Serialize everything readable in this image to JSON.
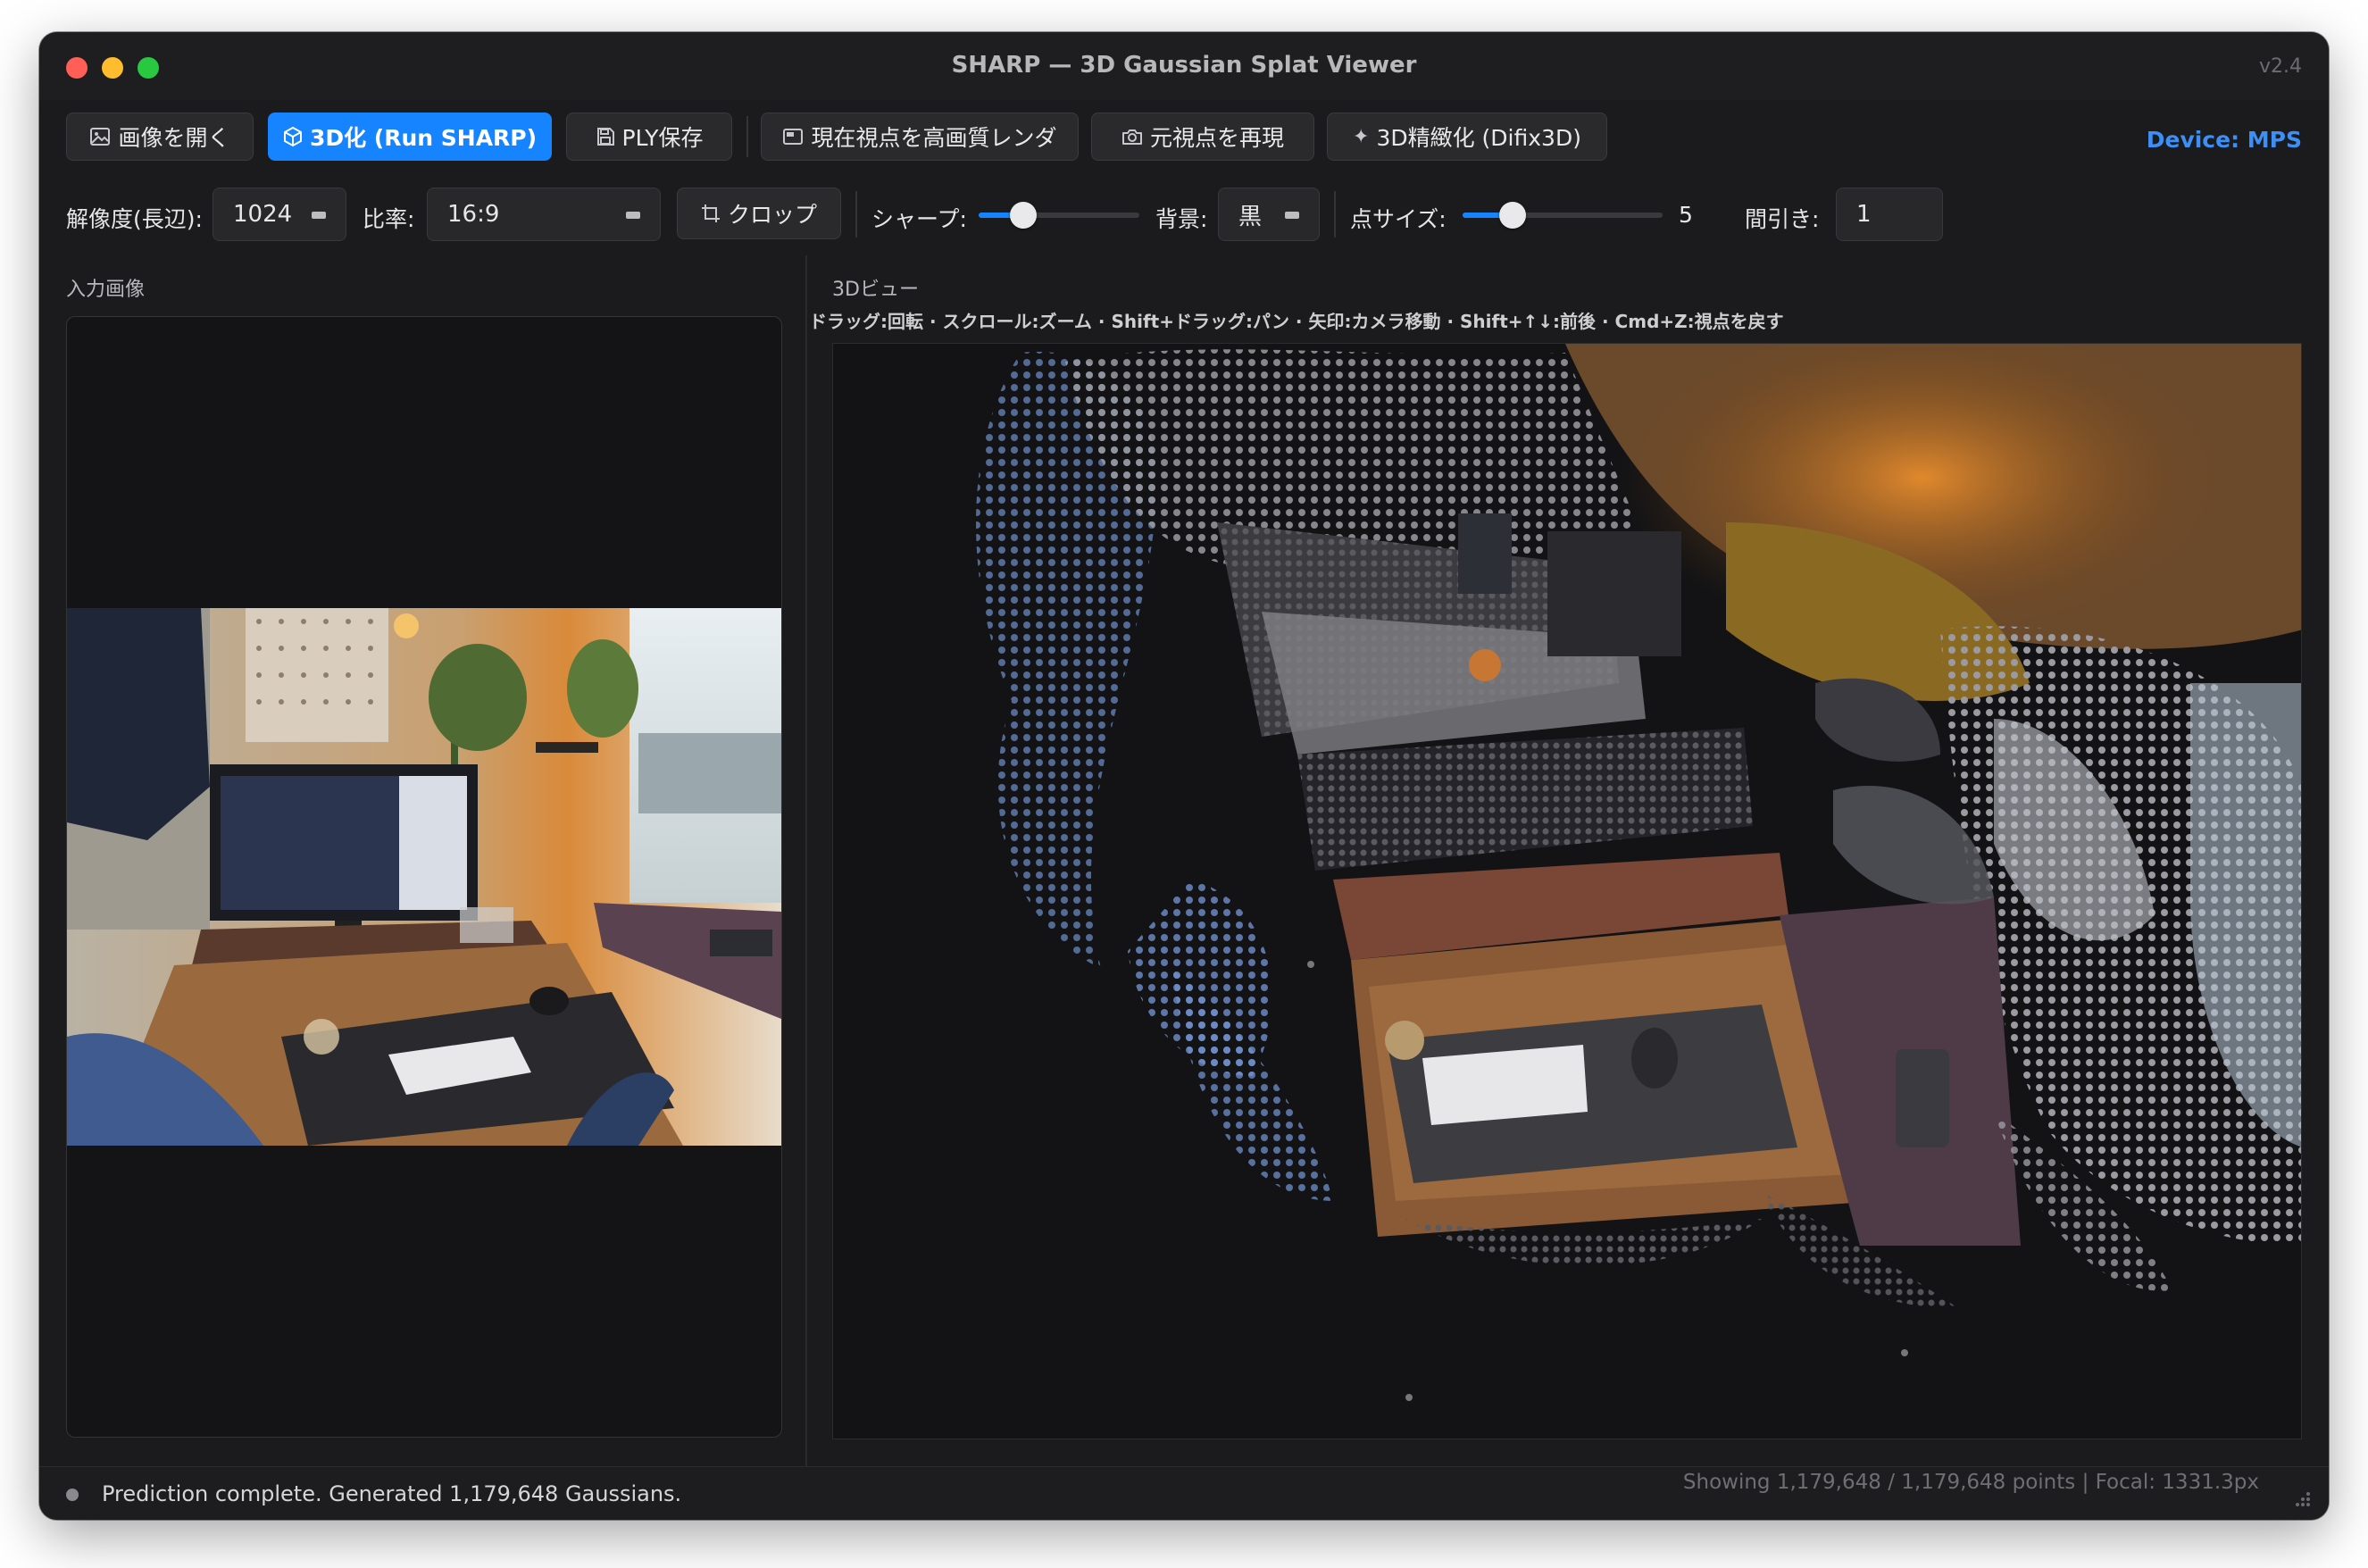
{
  "window": {
    "title": "SHARP — 3D Gaussian Splat Viewer",
    "version": "v2.4"
  },
  "toolbar": {
    "open_image": {
      "label": "画像を開く",
      "icon": "image-icon"
    },
    "run_sharp": {
      "label": "3D化 (Run SHARP)",
      "icon": "cube-icon"
    },
    "save_ply": {
      "label": "PLY保存",
      "icon": "floppy-icon"
    },
    "render_hq": {
      "label": "現在視点を高画質レンダ",
      "icon": "render-icon"
    },
    "reset_view": {
      "label": "元視点を再現",
      "icon": "camera-icon"
    },
    "refine": {
      "label": "3D精緻化 (Difix3D)",
      "icon": "sparkle-icon"
    },
    "device": "Device: MPS"
  },
  "settings": {
    "resolution_label": "解像度(長辺):",
    "resolution_value": "1024",
    "ratio_label": "比率:",
    "ratio_value": "16:9",
    "crop_label": "クロップ",
    "sharp_label": "シャープ:",
    "sharp_level": 0.28,
    "bg_label": "背景:",
    "bg_value": "黒",
    "point_size_label": "点サイズ:",
    "point_size_value": "5",
    "point_size_level": 0.25,
    "thinning_label": "間引き:",
    "thinning_value": "1"
  },
  "left_panel": {
    "title": "入力画像"
  },
  "view_panel": {
    "title": "3Dビュー",
    "hint": "ドラッグ:回転 · スクロール:ズーム · Shift+ドラッグ:パン · 矢印:カメラ移動 · Shift+↑↓:前後 · Cmd+Z:視点を戻す"
  },
  "status": {
    "message": "Prediction complete. Generated 1,179,648 Gaussians.",
    "stats": "Showing 1,179,648 / 1,179,648 points | Focal: 1331.3px"
  },
  "colors": {
    "accent": "#1684ff",
    "device": "#3d8ff5",
    "background": "#1b1b1d"
  }
}
